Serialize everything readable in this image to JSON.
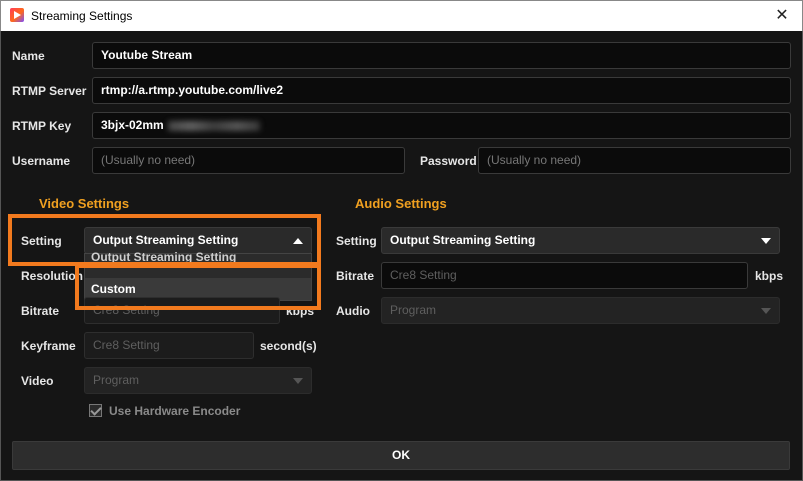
{
  "window": {
    "title": "Streaming Settings",
    "close_glyph": "✕"
  },
  "fields": {
    "name": {
      "label": "Name",
      "value": "Youtube Stream"
    },
    "rtmp_server": {
      "label": "RTMP Server",
      "value": "rtmp://a.rtmp.youtube.com/live2"
    },
    "rtmp_key": {
      "label": "RTMP Key",
      "value": "3bjx-02mm"
    },
    "username": {
      "label": "Username",
      "placeholder": "(Usually no need)"
    },
    "password": {
      "label": "Password",
      "placeholder": "(Usually no need)"
    }
  },
  "video": {
    "title": "Video Settings",
    "setting": {
      "label": "Setting",
      "value": "Output Streaming Setting"
    },
    "dropdown": {
      "options": [
        "Output Streaming Setting",
        "Custom"
      ]
    },
    "resolution": {
      "label": "Resolution"
    },
    "bitrate": {
      "label": "Bitrate",
      "placeholder": "Cre8 Setting",
      "unit": "kbps"
    },
    "keyframe": {
      "label": "Keyframe",
      "placeholder": "Cre8 Setting",
      "unit": "second(s)"
    },
    "video": {
      "label": "Video",
      "value": "Program"
    },
    "hw_encoder": {
      "label": "Use Hardware Encoder",
      "checked": true
    }
  },
  "audio": {
    "title": "Audio Settings",
    "setting": {
      "label": "Setting",
      "value": "Output Streaming Setting"
    },
    "bitrate": {
      "label": "Bitrate",
      "placeholder": "Cre8 Setting",
      "unit": "kbps"
    },
    "audio": {
      "label": "Audio",
      "value": "Program"
    }
  },
  "ok_label": "OK",
  "colors": {
    "accent": "#f0a020",
    "highlight": "#f27a1e",
    "background": "#151515"
  }
}
